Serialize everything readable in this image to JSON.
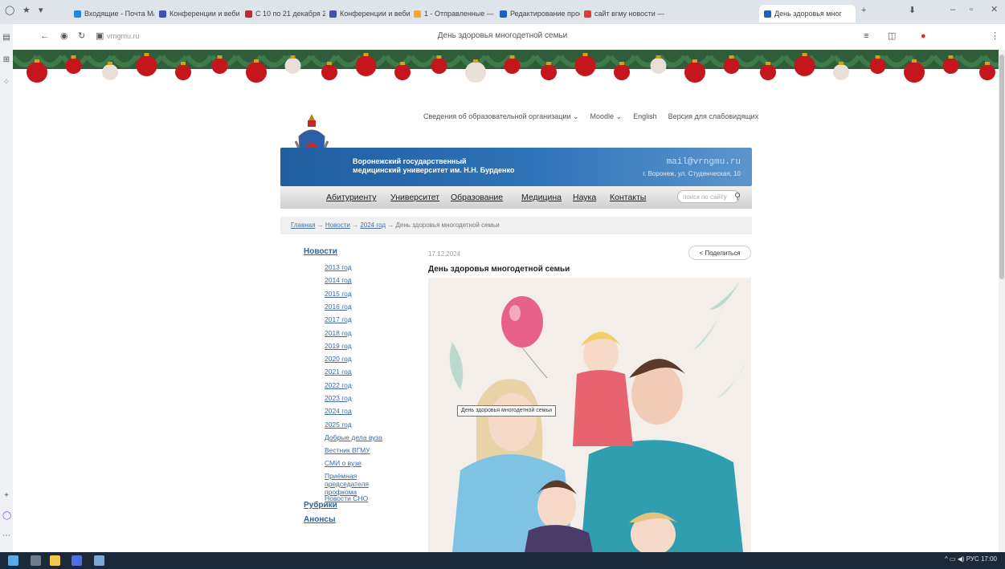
{
  "browser": {
    "tabs": [
      {
        "label": "Входящие - Почта Mail",
        "color": "#1e88e5"
      },
      {
        "label": "Конференции и вебин",
        "color": "#3f51b5"
      },
      {
        "label": "С 10 по 21 декабря 20",
        "color": "#c62828"
      },
      {
        "label": "Конференции и вебин",
        "color": "#3f51b5"
      },
      {
        "label": "1 - Отправленные — Я",
        "color": "#f9a825"
      },
      {
        "label": "Редактирование прос",
        "color": "#1565c0"
      },
      {
        "label": "сайт вгму новости — Я",
        "color": "#e53935"
      },
      {
        "label": "День здоровья мног",
        "color": "#1565c0",
        "active": true
      }
    ],
    "address_short": "vrngmu.ru",
    "page_title": "День здоровья многодетной семьи"
  },
  "site": {
    "top_links": [
      "Сведения об образовательной организации ⌄",
      "Moodle ⌄",
      "English",
      "Версия для слабовидящих"
    ],
    "university_line1": "Воронежский государственный",
    "university_line2": "медицинский университет им. Н.Н. Бурденко",
    "email": "mail@vrngmu.ru",
    "address": "г. Воронеж, ул. Студенческая, 10",
    "menu": [
      "Абитуриенту",
      "Университет",
      "Образование",
      "Медицина",
      "Наука",
      "Контакты"
    ],
    "search_placeholder": "поиск по сайту",
    "breadcrumb": [
      "Главная",
      "Новости",
      "2024 год",
      "День здоровья многодетной семьи"
    ],
    "sidebar": {
      "news_heading": "Новости",
      "years": [
        "2013 год",
        "2014 год",
        "2015 год",
        "2016 год",
        "2017 год",
        "2018 год",
        "2019 год",
        "2020 год",
        "2021 год",
        "2022 год",
        "2023 год",
        "2024 год",
        "2025 год"
      ],
      "extra": [
        "Добрые дела вуза",
        "Вестник ВГМУ",
        "СМИ о вузе",
        "Приёмная председателя профкома",
        "Новости СНО"
      ],
      "rubrics": "Рубрики",
      "announcements": "Анонсы"
    },
    "article": {
      "date": "17.12.2024",
      "title": "День здоровья многодетной семьи",
      "share": "Поделиться",
      "tooltip": "День здоровья многодетной семьи"
    }
  }
}
